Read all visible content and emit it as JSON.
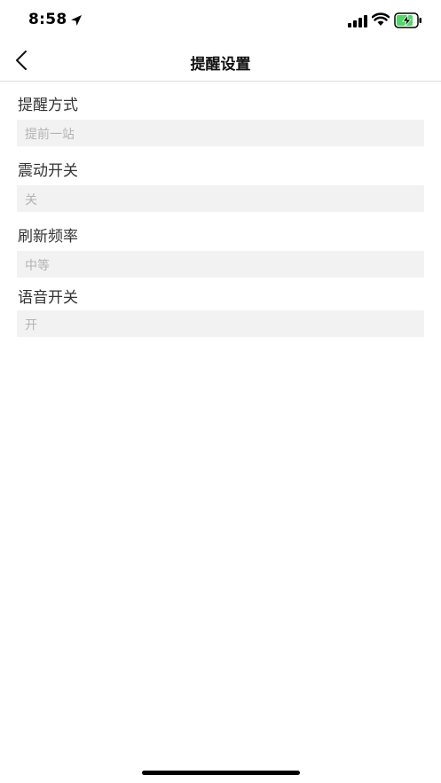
{
  "status_bar": {
    "time": "8:58",
    "icons": [
      "location-arrow-icon",
      "signal-icon",
      "wifi-icon",
      "battery-charging-icon"
    ],
    "battery_color": "#4cd964"
  },
  "nav": {
    "back_icon": "chevron-left-icon",
    "title": "提醒设置"
  },
  "settings": [
    {
      "label": "提醒方式",
      "value": "提前一站"
    },
    {
      "label": "震动开关",
      "value": "关"
    },
    {
      "label": "刷新频率",
      "value": "中等"
    },
    {
      "label": "语音开关",
      "value": "开"
    }
  ],
  "colors": {
    "field_background": "#f2f2f2",
    "placeholder_text": "#b3b3b3",
    "label_text": "#333333"
  }
}
